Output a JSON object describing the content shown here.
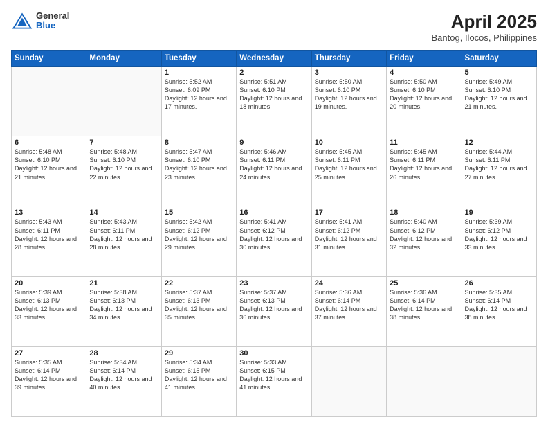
{
  "header": {
    "logo": {
      "line1": "General",
      "line2": "Blue"
    },
    "title": "April 2025",
    "subtitle": "Bantog, Ilocos, Philippines"
  },
  "days_of_week": [
    "Sunday",
    "Monday",
    "Tuesday",
    "Wednesday",
    "Thursday",
    "Friday",
    "Saturday"
  ],
  "weeks": [
    [
      {
        "day": "",
        "sunrise": "",
        "sunset": "",
        "daylight": ""
      },
      {
        "day": "",
        "sunrise": "",
        "sunset": "",
        "daylight": ""
      },
      {
        "day": "1",
        "sunrise": "Sunrise: 5:52 AM",
        "sunset": "Sunset: 6:09 PM",
        "daylight": "Daylight: 12 hours and 17 minutes."
      },
      {
        "day": "2",
        "sunrise": "Sunrise: 5:51 AM",
        "sunset": "Sunset: 6:10 PM",
        "daylight": "Daylight: 12 hours and 18 minutes."
      },
      {
        "day": "3",
        "sunrise": "Sunrise: 5:50 AM",
        "sunset": "Sunset: 6:10 PM",
        "daylight": "Daylight: 12 hours and 19 minutes."
      },
      {
        "day": "4",
        "sunrise": "Sunrise: 5:50 AM",
        "sunset": "Sunset: 6:10 PM",
        "daylight": "Daylight: 12 hours and 20 minutes."
      },
      {
        "day": "5",
        "sunrise": "Sunrise: 5:49 AM",
        "sunset": "Sunset: 6:10 PM",
        "daylight": "Daylight: 12 hours and 21 minutes."
      }
    ],
    [
      {
        "day": "6",
        "sunrise": "Sunrise: 5:48 AM",
        "sunset": "Sunset: 6:10 PM",
        "daylight": "Daylight: 12 hours and 21 minutes."
      },
      {
        "day": "7",
        "sunrise": "Sunrise: 5:48 AM",
        "sunset": "Sunset: 6:10 PM",
        "daylight": "Daylight: 12 hours and 22 minutes."
      },
      {
        "day": "8",
        "sunrise": "Sunrise: 5:47 AM",
        "sunset": "Sunset: 6:10 PM",
        "daylight": "Daylight: 12 hours and 23 minutes."
      },
      {
        "day": "9",
        "sunrise": "Sunrise: 5:46 AM",
        "sunset": "Sunset: 6:11 PM",
        "daylight": "Daylight: 12 hours and 24 minutes."
      },
      {
        "day": "10",
        "sunrise": "Sunrise: 5:45 AM",
        "sunset": "Sunset: 6:11 PM",
        "daylight": "Daylight: 12 hours and 25 minutes."
      },
      {
        "day": "11",
        "sunrise": "Sunrise: 5:45 AM",
        "sunset": "Sunset: 6:11 PM",
        "daylight": "Daylight: 12 hours and 26 minutes."
      },
      {
        "day": "12",
        "sunrise": "Sunrise: 5:44 AM",
        "sunset": "Sunset: 6:11 PM",
        "daylight": "Daylight: 12 hours and 27 minutes."
      }
    ],
    [
      {
        "day": "13",
        "sunrise": "Sunrise: 5:43 AM",
        "sunset": "Sunset: 6:11 PM",
        "daylight": "Daylight: 12 hours and 28 minutes."
      },
      {
        "day": "14",
        "sunrise": "Sunrise: 5:43 AM",
        "sunset": "Sunset: 6:11 PM",
        "daylight": "Daylight: 12 hours and 28 minutes."
      },
      {
        "day": "15",
        "sunrise": "Sunrise: 5:42 AM",
        "sunset": "Sunset: 6:12 PM",
        "daylight": "Daylight: 12 hours and 29 minutes."
      },
      {
        "day": "16",
        "sunrise": "Sunrise: 5:41 AM",
        "sunset": "Sunset: 6:12 PM",
        "daylight": "Daylight: 12 hours and 30 minutes."
      },
      {
        "day": "17",
        "sunrise": "Sunrise: 5:41 AM",
        "sunset": "Sunset: 6:12 PM",
        "daylight": "Daylight: 12 hours and 31 minutes."
      },
      {
        "day": "18",
        "sunrise": "Sunrise: 5:40 AM",
        "sunset": "Sunset: 6:12 PM",
        "daylight": "Daylight: 12 hours and 32 minutes."
      },
      {
        "day": "19",
        "sunrise": "Sunrise: 5:39 AM",
        "sunset": "Sunset: 6:12 PM",
        "daylight": "Daylight: 12 hours and 33 minutes."
      }
    ],
    [
      {
        "day": "20",
        "sunrise": "Sunrise: 5:39 AM",
        "sunset": "Sunset: 6:13 PM",
        "daylight": "Daylight: 12 hours and 33 minutes."
      },
      {
        "day": "21",
        "sunrise": "Sunrise: 5:38 AM",
        "sunset": "Sunset: 6:13 PM",
        "daylight": "Daylight: 12 hours and 34 minutes."
      },
      {
        "day": "22",
        "sunrise": "Sunrise: 5:37 AM",
        "sunset": "Sunset: 6:13 PM",
        "daylight": "Daylight: 12 hours and 35 minutes."
      },
      {
        "day": "23",
        "sunrise": "Sunrise: 5:37 AM",
        "sunset": "Sunset: 6:13 PM",
        "daylight": "Daylight: 12 hours and 36 minutes."
      },
      {
        "day": "24",
        "sunrise": "Sunrise: 5:36 AM",
        "sunset": "Sunset: 6:14 PM",
        "daylight": "Daylight: 12 hours and 37 minutes."
      },
      {
        "day": "25",
        "sunrise": "Sunrise: 5:36 AM",
        "sunset": "Sunset: 6:14 PM",
        "daylight": "Daylight: 12 hours and 38 minutes."
      },
      {
        "day": "26",
        "sunrise": "Sunrise: 5:35 AM",
        "sunset": "Sunset: 6:14 PM",
        "daylight": "Daylight: 12 hours and 38 minutes."
      }
    ],
    [
      {
        "day": "27",
        "sunrise": "Sunrise: 5:35 AM",
        "sunset": "Sunset: 6:14 PM",
        "daylight": "Daylight: 12 hours and 39 minutes."
      },
      {
        "day": "28",
        "sunrise": "Sunrise: 5:34 AM",
        "sunset": "Sunset: 6:14 PM",
        "daylight": "Daylight: 12 hours and 40 minutes."
      },
      {
        "day": "29",
        "sunrise": "Sunrise: 5:34 AM",
        "sunset": "Sunset: 6:15 PM",
        "daylight": "Daylight: 12 hours and 41 minutes."
      },
      {
        "day": "30",
        "sunrise": "Sunrise: 5:33 AM",
        "sunset": "Sunset: 6:15 PM",
        "daylight": "Daylight: 12 hours and 41 minutes."
      },
      {
        "day": "",
        "sunrise": "",
        "sunset": "",
        "daylight": ""
      },
      {
        "day": "",
        "sunrise": "",
        "sunset": "",
        "daylight": ""
      },
      {
        "day": "",
        "sunrise": "",
        "sunset": "",
        "daylight": ""
      }
    ]
  ]
}
